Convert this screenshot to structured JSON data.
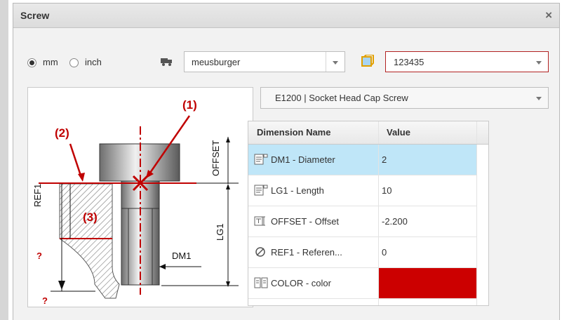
{
  "dialog": {
    "title": "Screw",
    "close_glyph": "×"
  },
  "units": {
    "options": [
      {
        "label": "mm",
        "checked": true
      },
      {
        "label": "inch",
        "checked": false
      }
    ]
  },
  "supplier": {
    "icon": "truck-icon",
    "selected": "meusburger"
  },
  "part_number": {
    "icon": "cube-icon",
    "value": "123435",
    "border_color": "#b22222"
  },
  "product": {
    "selected": "E1200 | Socket Head Cap Screw"
  },
  "figure": {
    "labels": [
      "(1)",
      "(2)",
      "(3)",
      "REF1",
      "OFFSET",
      "LG1",
      "DM1",
      "?",
      "?"
    ],
    "accent_color": "#c00000"
  },
  "grid": {
    "columns": [
      "Dimension Name",
      "Value"
    ],
    "rows": [
      {
        "icon": "text-field-icon",
        "name": "DM1 - Diameter",
        "value": "2",
        "selected": true
      },
      {
        "icon": "text-field-icon",
        "name": "LG1 - Length",
        "value": "10",
        "selected": false
      },
      {
        "icon": "offset-icon",
        "name": "OFFSET - Offset",
        "value": "-2.200",
        "selected": false
      },
      {
        "icon": "no-reference-icon",
        "name": "REF1 - Referen...",
        "value": "0",
        "selected": false
      },
      {
        "icon": "color-picker-icon",
        "name": "COLOR - color",
        "value": "",
        "swatch": "#cc0000",
        "selected": false
      }
    ]
  }
}
